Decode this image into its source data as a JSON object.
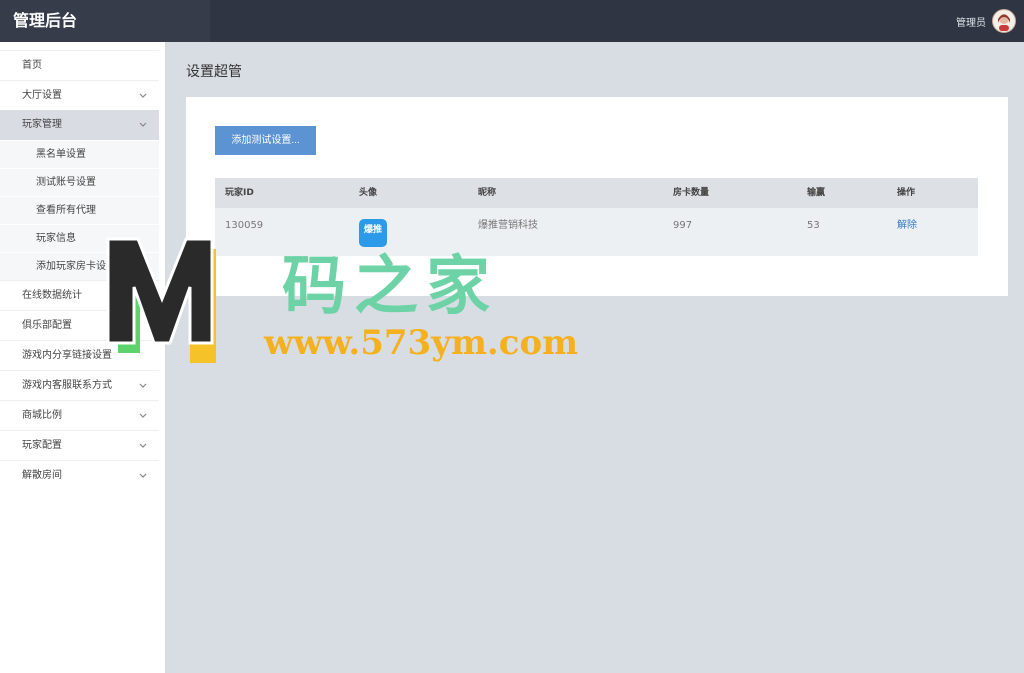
{
  "app": {
    "title": "管理后台",
    "user_name": "管理员"
  },
  "sidebar": {
    "items": [
      {
        "label": "首页",
        "has_arrow": false
      },
      {
        "label": "大厅设置",
        "has_arrow": true
      },
      {
        "label": "玩家管理",
        "has_arrow": true,
        "active": true
      },
      {
        "label": "在线数据统计",
        "has_arrow": false
      },
      {
        "label": "俱乐部配置",
        "has_arrow": false
      },
      {
        "label": "游戏内分享链接设置",
        "has_arrow": false
      },
      {
        "label": "游戏内客服联系方式",
        "has_arrow": true
      },
      {
        "label": "商城比例",
        "has_arrow": true
      },
      {
        "label": "玩家配置",
        "has_arrow": true
      },
      {
        "label": "解散房间",
        "has_arrow": true
      }
    ],
    "sub_items": [
      "黑名单设置",
      "测试账号设置",
      "查看所有代理",
      "玩家信息",
      "添加玩家房卡设置"
    ]
  },
  "main": {
    "page_title": "设置超管",
    "add_button": "添加测试设置...",
    "table": {
      "headers": {
        "id": "玩家ID",
        "avatar": "头像",
        "nickname": "昵称",
        "cards": "房卡数量",
        "score": "输赢",
        "action": "操作"
      },
      "rows": [
        {
          "id": "130059",
          "avatar_text": "爆推",
          "nickname": "爆推营销科技",
          "cards": "997",
          "score": "53",
          "action": "解除"
        }
      ]
    }
  },
  "watermark": {
    "text": "码之家",
    "url": "www.573ym.com",
    "logo_letter": "M"
  },
  "colors": {
    "topbar": "#2f3542",
    "accent": "#5b93d3",
    "link": "#3677c6"
  }
}
